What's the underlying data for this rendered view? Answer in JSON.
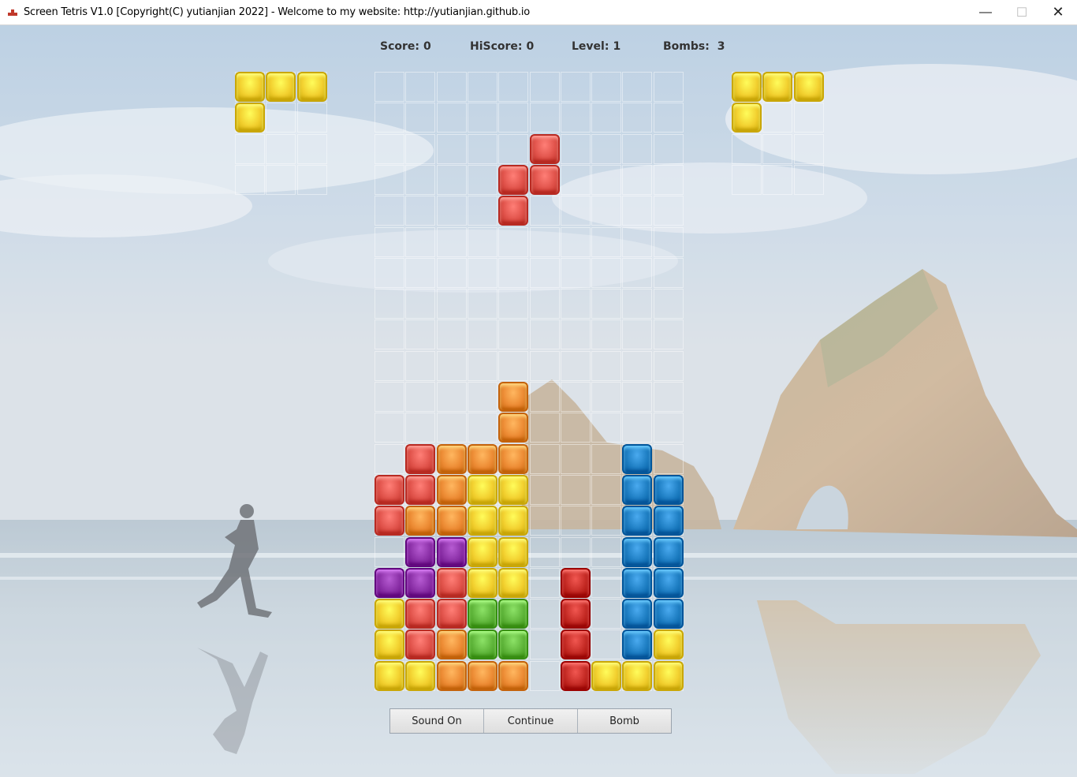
{
  "window": {
    "title": "Screen Tetris V1.0 [Copyright(C) yutianjian 2022] - Welcome to my website: http://yutianjian.github.io",
    "controls": {
      "minimize": "—",
      "maximize": "☐",
      "close": "✕"
    }
  },
  "stats": {
    "score_label": "Score:",
    "score_value": "0",
    "hiscore_label": "HiScore:",
    "hiscore_value": "0",
    "level_label": "Level:",
    "level_value": "1",
    "bombs_label": "Bombs: ",
    "bombs_value": "3"
  },
  "colors": {
    "yellow": "#f2cf2e",
    "red": "#e0524a",
    "orange": "#ec8a33",
    "purple": "#8a2fa6",
    "green": "#5fb53a",
    "blue": "#1d7dc2",
    "darkred": "#c42a24"
  },
  "board": {
    "columns": 10,
    "rows": 20,
    "active_piece": {
      "color": "red",
      "cells": [
        [
          5,
          2
        ],
        [
          4,
          3
        ],
        [
          5,
          3
        ],
        [
          4,
          4
        ]
      ]
    },
    "stack": [
      {
        "row": 10,
        "cells": {
          "4": "orange"
        }
      },
      {
        "row": 11,
        "cells": {
          "4": "orange"
        }
      },
      {
        "row": 12,
        "cells": {
          "1": "red",
          "2": "orange",
          "3": "orange",
          "4": "orange",
          "8": "blue"
        }
      },
      {
        "row": 13,
        "cells": {
          "0": "red",
          "1": "red",
          "2": "orange",
          "3": "yellow",
          "4": "yellow",
          "8": "blue",
          "9": "blue"
        }
      },
      {
        "row": 14,
        "cells": {
          "0": "red",
          "1": "orange",
          "2": "orange",
          "3": "yellow",
          "4": "yellow",
          "8": "blue",
          "9": "blue"
        }
      },
      {
        "row": 15,
        "cells": {
          "1": "purple",
          "2": "purple",
          "3": "yellow",
          "4": "yellow",
          "8": "blue",
          "9": "blue"
        }
      },
      {
        "row": 16,
        "cells": {
          "0": "purple",
          "1": "purple",
          "2": "red",
          "3": "yellow",
          "4": "yellow",
          "6": "darkred",
          "8": "blue",
          "9": "blue"
        }
      },
      {
        "row": 17,
        "cells": {
          "0": "yellow",
          "1": "red",
          "2": "red",
          "3": "green",
          "4": "green",
          "6": "darkred",
          "8": "blue",
          "9": "blue"
        }
      },
      {
        "row": 18,
        "cells": {
          "0": "yellow",
          "1": "red",
          "2": "orange",
          "3": "green",
          "4": "green",
          "6": "darkred",
          "8": "blue",
          "9": "yellow"
        }
      },
      {
        "row": 19,
        "cells": {
          "0": "yellow",
          "1": "yellow",
          "2": "orange",
          "3": "orange",
          "4": "orange",
          "6": "darkred",
          "7": "yellow",
          "8": "yellow",
          "9": "yellow"
        }
      }
    ]
  },
  "preview_left": {
    "columns": 3,
    "rows": 4,
    "color": "yellow",
    "cells": [
      [
        0,
        0
      ],
      [
        1,
        0
      ],
      [
        2,
        0
      ],
      [
        0,
        1
      ]
    ]
  },
  "preview_right": {
    "columns": 3,
    "rows": 4,
    "color": "yellow",
    "cells": [
      [
        0,
        0
      ],
      [
        1,
        0
      ],
      [
        2,
        0
      ],
      [
        0,
        1
      ]
    ]
  },
  "buttons": {
    "sound": "Sound On",
    "continue": "Continue",
    "bomb": "Bomb"
  }
}
